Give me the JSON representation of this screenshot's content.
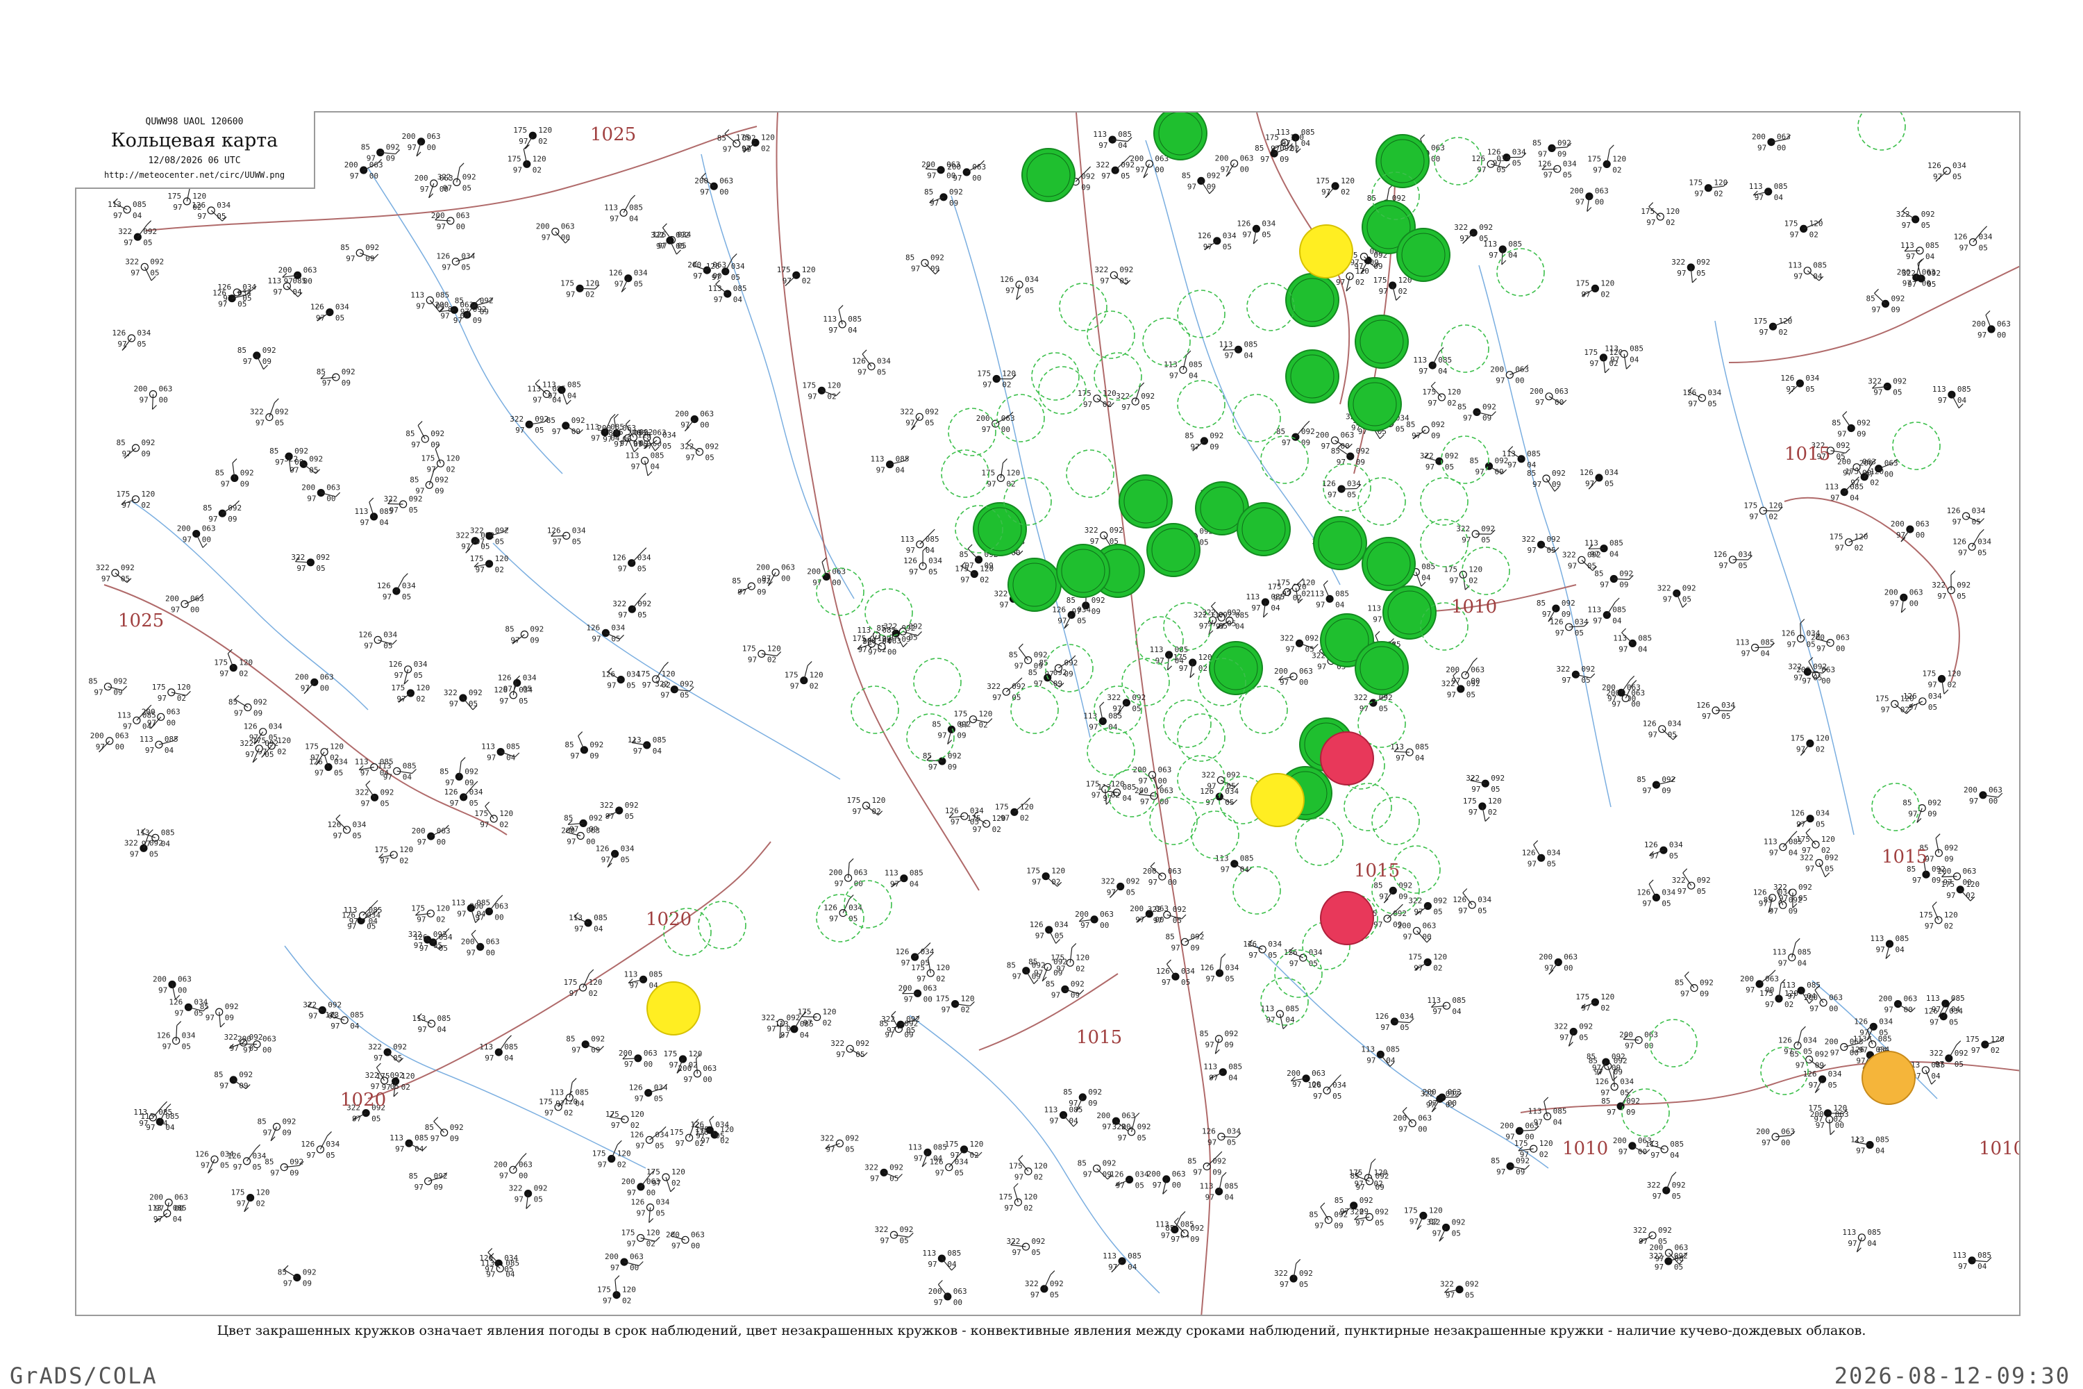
{
  "header": {
    "code": "QUWW98  UAOL  120600",
    "title": "Кольцевая карта",
    "datetime": "12/08/2026 06 UTC",
    "url": "http://meteocenter.net/circ/UUWW.png"
  },
  "caption": "Цвет закрашенных кружков означает явления погоды в срок наблюдений, цвет незакрашенных кружков - конвективные явления между сроками наблюдений, пунктирные незакрашенные кружки - наличие кучево-дождевых облаков.",
  "footer": {
    "left": "GrADS/COLA",
    "right": "2026-08-12-09:30"
  },
  "colors": {
    "isobar": "#b06a6a",
    "river": "#7aaee0",
    "filled_green": "#1fbf2f",
    "filled_yellow": "#ffee22",
    "filled_red": "#e8385a",
    "filled_orange": "#f5b53a",
    "dashed_green": "#3bbf4a"
  },
  "isobar_labels": [
    "1025",
    "1025",
    "1020",
    "1020",
    "1015",
    "1015",
    "1015",
    "1010",
    "1010",
    "1010",
    "1015"
  ],
  "stations_sample": [
    {
      "temp": "126",
      "pressure": "034",
      "dew": "97",
      "tend": "05"
    },
    {
      "temp": "85",
      "pressure": "092",
      "dew": "97",
      "tend": "09"
    },
    {
      "temp": "322",
      "pressure": "092",
      "dew": "97",
      "tend": "05"
    },
    {
      "temp": "175",
      "pressure": "120",
      "dew": "97",
      "tend": "02"
    },
    {
      "temp": "113",
      "pressure": "085",
      "dew": "97",
      "tend": "04"
    },
    {
      "temp": "200",
      "pressure": "063",
      "dew": "97",
      "tend": "00"
    }
  ]
}
